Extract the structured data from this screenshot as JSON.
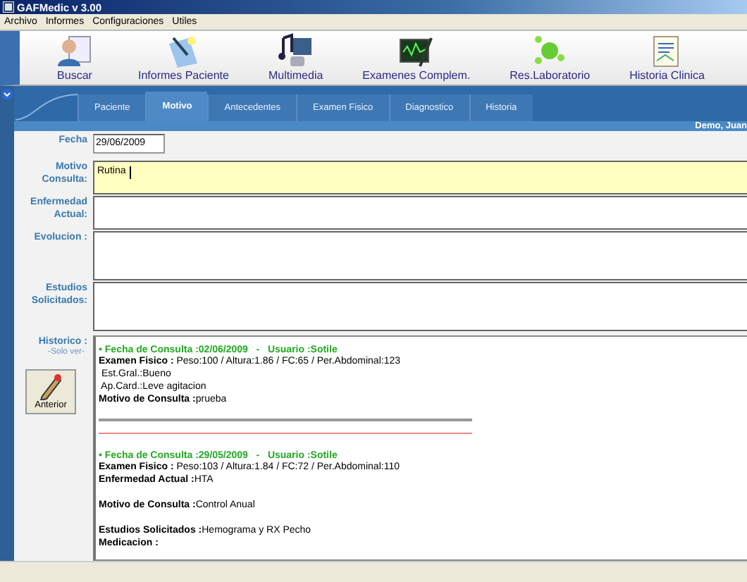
{
  "window": {
    "title": "GAFMedic v 3.00"
  },
  "menu": [
    "Archivo",
    "Informes",
    "Configuraciones",
    "Utiles"
  ],
  "toolbar": [
    {
      "label": "Buscar",
      "kind": "person"
    },
    {
      "label": "Informes Paciente",
      "kind": "pen"
    },
    {
      "label": "Multimedia",
      "kind": "media"
    },
    {
      "label": "Examenes Complem.",
      "kind": "monitor"
    },
    {
      "label": "Res.Laboratorio",
      "kind": "molecule"
    },
    {
      "label": "Historia Clinica",
      "kind": "notebook"
    }
  ],
  "tabs": [
    {
      "label": "Paciente",
      "selected": false
    },
    {
      "label": "Motivo",
      "selected": true
    },
    {
      "label": "Antecedentes",
      "selected": false
    },
    {
      "label": "Examen Fisico",
      "selected": false
    },
    {
      "label": "Diagnostico",
      "selected": false
    },
    {
      "label": "Historia",
      "selected": false
    }
  ],
  "user": "Demo, Juan",
  "form": {
    "date_label": "Fecha",
    "date": "29/06/2009",
    "fields": [
      {
        "label": "Motivo Consulta:",
        "value": "Rutina",
        "focused": true
      },
      {
        "label": "Enfermedad Actual:",
        "focused": false
      },
      {
        "label": "Evolucion :",
        "focused": false
      },
      {
        "label": "Estudios Solicitados:",
        "focused": false
      }
    ]
  },
  "history": {
    "label": "Historico :",
    "note": "-Solo ver-",
    "button": "Anterior",
    "entries": [
      {
        "header": "• Fecha de Consulta :02/06/2009   -   Usuario :Sotile",
        "groups": [
          [
            "**Examen Fisico :** Peso:100 / Altura:1.86 / FC:65 / Per.Abdominal:123",
            " Est.Gral.:Bueno",
            " Ap.Card.:Leve agitacion",
            "**Motivo de Consulta :**prueba"
          ]
        ]
      },
      {
        "header": "• Fecha de Consulta :29/05/2009   -   Usuario :Sotile",
        "groups": [
          [
            "**Examen Fisico :** Peso:103 / Altura:1.84 / FC:72 / Per.Abdominal:110",
            "**Enfermedad Actual :**HTA"
          ],
          [
            "**Motivo de Consulta :**Control Anual"
          ],
          [
            "**Estudios Solicitados :**Hemograma y RX Pecho",
            "**Medicacion :**"
          ]
        ]
      }
    ]
  }
}
